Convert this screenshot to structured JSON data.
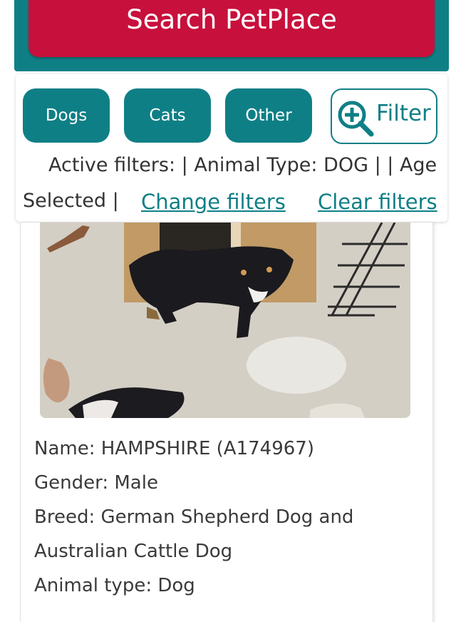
{
  "header": {
    "search_label": "Search PetPlace"
  },
  "filters": {
    "tabs": [
      {
        "label": "Dogs"
      },
      {
        "label": "Cats"
      },
      {
        "label": "Other"
      }
    ],
    "filter_button_label": "Filter",
    "active_filters_line1": "Active filters: | Animal Type: DOG | | Age",
    "active_filters_line2": "Selected |",
    "change_filters": "Change filters",
    "clear_filters": "Clear filters"
  },
  "pet": {
    "photo_icon": "dog-photo",
    "name": "Name: HAMPSHIRE (A174967)",
    "gender": "Gender: Male",
    "breed_line1": "Breed: German Shepherd Dog and",
    "breed_line2": "Australian Cattle Dog",
    "animal_type": "Animal type: Dog"
  },
  "colors": {
    "brand_teal": "#0f7f86",
    "search_red": "#c8103c",
    "text_dark": "#333333"
  }
}
